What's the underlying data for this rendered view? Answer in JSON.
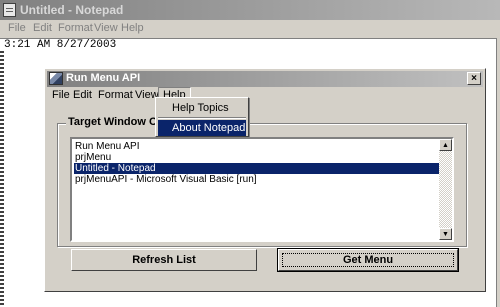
{
  "notepad": {
    "title": "Untitled - Notepad",
    "menu": [
      "File",
      "Edit",
      "Format",
      "View",
      "Help"
    ],
    "content": "3:21 AM 8/27/2003"
  },
  "dialog": {
    "title": "Run Menu API",
    "close_label": "×",
    "menu": [
      "File",
      "Edit",
      "Format",
      "View",
      "Help"
    ],
    "groupbox_label": "Target Window Capt",
    "list_items": [
      "Run Menu API",
      "prjMenu",
      "Untitled - Notepad",
      "prjMenuAPI - Microsoft Visual Basic [run]"
    ],
    "selected_index": 2,
    "refresh_button": "Refresh List",
    "get_menu_button": "Get Menu"
  },
  "help_dropdown": {
    "items": [
      "Help Topics",
      "About Notepad"
    ],
    "selected_index": 1
  },
  "colors": {
    "selection": "#0a246a",
    "face": "#d4d0c8"
  }
}
